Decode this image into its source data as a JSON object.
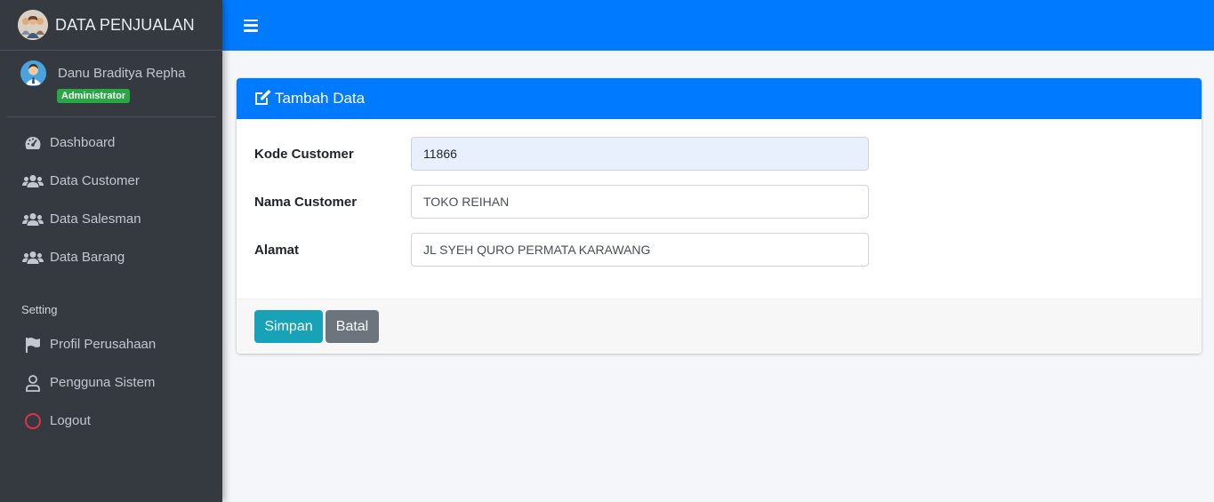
{
  "brand": {
    "title": "DATA PENJUALAN",
    "logo_icon": "team-logo-icon"
  },
  "user": {
    "name": "Danu Braditya Repha",
    "role": "Administrator",
    "avatar_icon": "user-avatar-icon"
  },
  "sidebar": {
    "items": [
      {
        "label": "Dashboard",
        "icon": "tachometer-icon"
      },
      {
        "label": "Data Customer",
        "icon": "users-icon"
      },
      {
        "label": "Data Salesman",
        "icon": "users-icon"
      },
      {
        "label": "Data Barang",
        "icon": "users-icon"
      }
    ],
    "setting_header": "Setting",
    "setting_items": [
      {
        "label": "Profil Perusahaan",
        "icon": "flag-icon"
      },
      {
        "label": "Pengguna Sistem",
        "icon": "user-outline-icon"
      },
      {
        "label": "Logout",
        "icon": "circle-icon"
      }
    ]
  },
  "topbar": {
    "menu_icon": "hamburger-icon"
  },
  "card": {
    "title": "Tambah Data",
    "title_icon": "edit-icon",
    "fields": [
      {
        "label": "Kode Customer",
        "value": "11866"
      },
      {
        "label": "Nama Customer",
        "value": "TOKO REIHAN"
      },
      {
        "label": "Alamat",
        "value": "JL SYEH QURO PERMATA KARAWANG"
      }
    ],
    "save_label": "Simpan",
    "cancel_label": "Batal"
  },
  "colors": {
    "primary": "#007bff",
    "sidebar_bg": "#343a40",
    "badge": "#28a745",
    "save_button": "#17a2b8",
    "cancel_button": "#6c757d",
    "logout_icon": "#dc3545"
  }
}
